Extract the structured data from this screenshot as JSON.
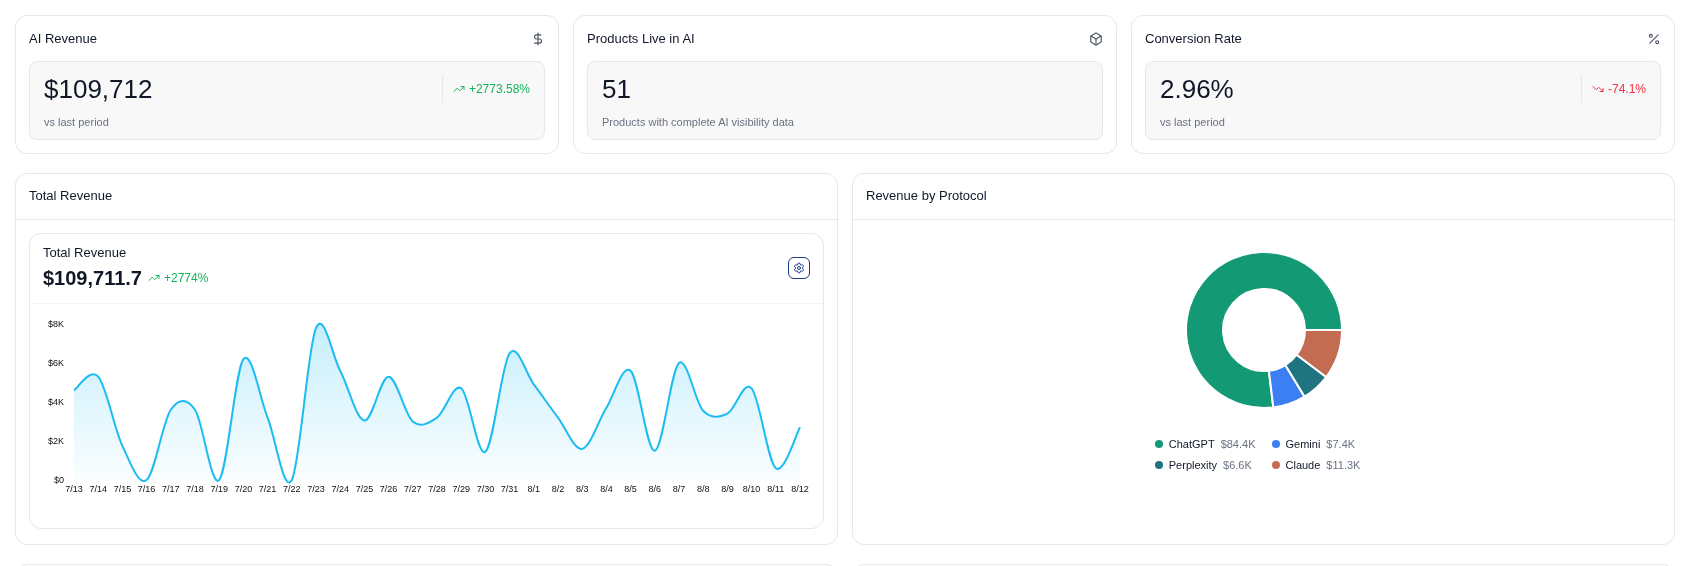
{
  "metrics": [
    {
      "title": "AI Revenue",
      "value": "$109,712",
      "caption": "vs last period",
      "change": {
        "text": "+2773.58%",
        "positive": true
      }
    },
    {
      "title": "Products Live in AI",
      "value": "51",
      "caption": "Products with complete AI visibility data"
    },
    {
      "title": "Conversion Rate",
      "value": "2.96%",
      "caption": "vs last period",
      "change": {
        "text": "-74.1%",
        "positive": false
      }
    }
  ],
  "total_revenue": {
    "title": "Total Revenue",
    "inner_title": "Total Revenue",
    "value": "$109,711.7",
    "change": {
      "text": "+2774%",
      "positive": true
    },
    "chart_data": {
      "type": "area",
      "categories": [
        "7/13",
        "7/14",
        "7/15",
        "7/16",
        "7/17",
        "7/18",
        "7/19",
        "7/20",
        "7/21",
        "7/22",
        "7/23",
        "7/24",
        "7/25",
        "7/26",
        "7/27",
        "7/28",
        "7/29",
        "7/30",
        "7/31",
        "8/1",
        "8/2",
        "8/3",
        "8/4",
        "8/5",
        "8/6",
        "8/7",
        "8/8",
        "8/9",
        "8/10",
        "8/11",
        "8/12"
      ],
      "ylim": [
        0,
        8000
      ],
      "yticks": [
        {
          "value": 0,
          "label": "$0"
        },
        {
          "value": 2000,
          "label": "$2K"
        },
        {
          "value": 4000,
          "label": "$4K"
        },
        {
          "value": 6000,
          "label": "$6K"
        },
        {
          "value": 8000,
          "label": "$8K"
        }
      ],
      "series": [
        {
          "color": "#1cbcf2",
          "values": [
            4600,
            5300,
            1750,
            0,
            3600,
            3600,
            0,
            6200,
            3200,
            0,
            7800,
            5600,
            3050,
            5300,
            3000,
            3200,
            4700,
            1450,
            6500,
            4900,
            3200,
            1600,
            3700,
            5600,
            1500,
            6000,
            3550,
            3400,
            4700,
            600,
            2700
          ]
        }
      ]
    }
  },
  "revenue_by_protocol": {
    "title": "Revenue by Protocol",
    "chart_data": {
      "type": "donut",
      "categories": [
        "ChatGPT",
        "Gemini",
        "Perplexity",
        "Claude"
      ],
      "series": [
        {
          "values": [
            76.9,
            6.8,
            6.0,
            10.3
          ]
        }
      ]
    },
    "legend": [
      {
        "amount": "$84.4K",
        "color": "#139a74"
      },
      {
        "amount": "$7.4K",
        "color": "#3b7ff2"
      },
      {
        "amount": "$6.6K",
        "color": "#1f7480"
      },
      {
        "amount": "$11.3K",
        "color": "#c46c51"
      }
    ]
  }
}
